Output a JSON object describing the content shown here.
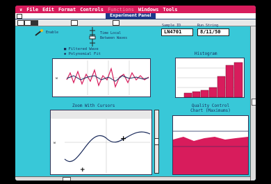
{
  "menu": {
    "apple": "❦",
    "items": [
      "File",
      "Edit",
      "Format",
      "Controls",
      "Functions",
      "Windows",
      "Tools"
    ],
    "disabled_index": 4
  },
  "window": {
    "title": "Experiment Panel"
  },
  "controls": {
    "enable_label": "Enable",
    "time_local_label": "Time Local",
    "between_waves_label": "Between Waves",
    "sample_id_label": "Sample ID",
    "sample_id_value": "LN4701",
    "run_string_label": "Run String",
    "run_string_value": "8/11/50"
  },
  "legend": {
    "filtered": "Filtered Wave",
    "poly": "Polynomial Fit"
  },
  "histogram": {
    "title": "Histogram"
  },
  "zoom": {
    "title": "Zoom With Cursors"
  },
  "qc": {
    "title": "Quality Control Chart (Maximums)"
  },
  "colors": {
    "screen": "#38c8d8",
    "menubar": "#d81c5c",
    "title": "#1e3a8c",
    "bars": "#d81c5c"
  }
}
